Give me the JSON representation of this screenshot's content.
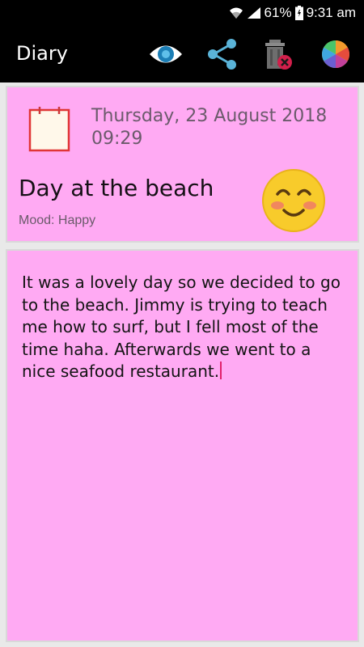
{
  "status_bar": {
    "battery": "61%",
    "time": "9:31 am"
  },
  "app_bar": {
    "title": "Diary"
  },
  "entry": {
    "date_line1": "Thursday, 23 August 2018",
    "date_line2": "09:29",
    "title": "Day at the beach",
    "mood_label": "Mood:",
    "mood_value": "Happy",
    "text": "It was a lovely day so we decided to go to the beach. Jimmy is trying to teach me how to surf, but I fell most of the time haha. Afterwards we went to a nice seafood restaurant."
  },
  "icons": {
    "view": "eye-icon",
    "share": "share-icon",
    "delete": "trash-icon",
    "theme": "color-wheel-icon",
    "calendar": "calendar-icon",
    "mood": "happy-face-icon"
  },
  "colors": {
    "card_background": "#ffaaf3",
    "app_bar": "#000000",
    "caret": "#e0206a"
  }
}
